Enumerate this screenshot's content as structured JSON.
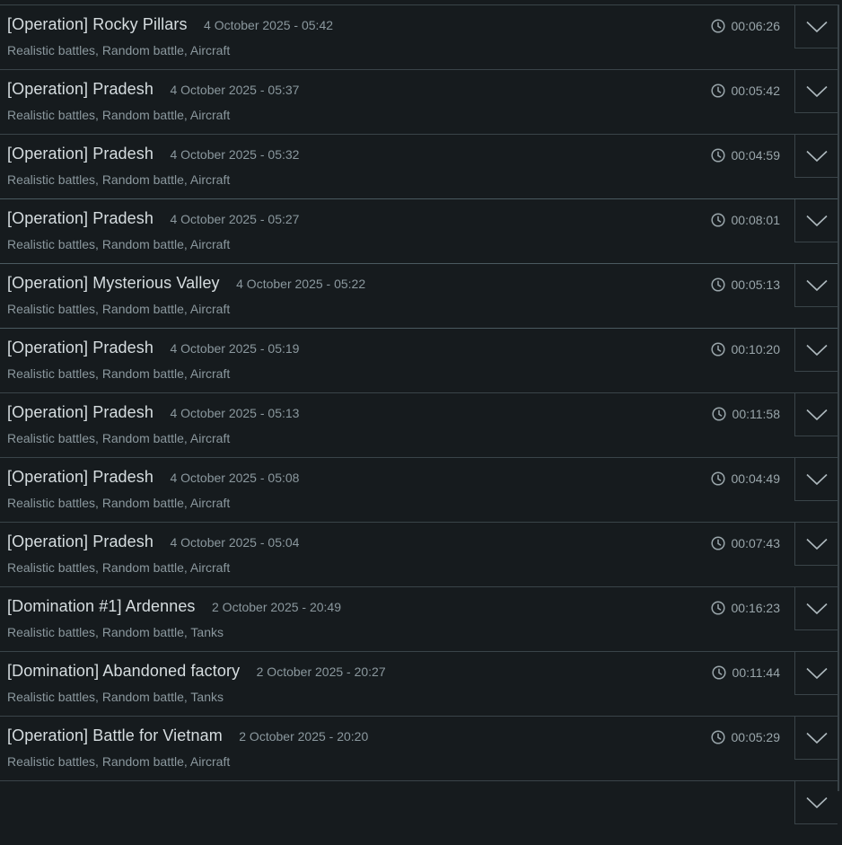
{
  "battles": [
    {
      "title": "[Operation] Rocky Pillars",
      "date": "4 October 2025 - 05:42",
      "meta": "Realistic battles, Random battle, Aircraft",
      "duration": "00:06:26"
    },
    {
      "title": "[Operation] Pradesh",
      "date": "4 October 2025 - 05:37",
      "meta": "Realistic battles, Random battle, Aircraft",
      "duration": "00:05:42"
    },
    {
      "title": "[Operation] Pradesh",
      "date": "4 October 2025 - 05:32",
      "meta": "Realistic battles, Random battle, Aircraft",
      "duration": "00:04:59"
    },
    {
      "title": "[Operation] Pradesh",
      "date": "4 October 2025 - 05:27",
      "meta": "Realistic battles, Random battle, Aircraft",
      "duration": "00:08:01"
    },
    {
      "title": "[Operation] Mysterious Valley",
      "date": "4 October 2025 - 05:22",
      "meta": "Realistic battles, Random battle, Aircraft",
      "duration": "00:05:13"
    },
    {
      "title": "[Operation] Pradesh",
      "date": "4 October 2025 - 05:19",
      "meta": "Realistic battles, Random battle, Aircraft",
      "duration": "00:10:20"
    },
    {
      "title": "[Operation] Pradesh",
      "date": "4 October 2025 - 05:13",
      "meta": "Realistic battles, Random battle, Aircraft",
      "duration": "00:11:58"
    },
    {
      "title": "[Operation] Pradesh",
      "date": "4 October 2025 - 05:08",
      "meta": "Realistic battles, Random battle, Aircraft",
      "duration": "00:04:49"
    },
    {
      "title": "[Operation] Pradesh",
      "date": "4 October 2025 - 05:04",
      "meta": "Realistic battles, Random battle, Aircraft",
      "duration": "00:07:43"
    },
    {
      "title": "[Domination #1] Ardennes",
      "date": "2 October 2025 - 20:49",
      "meta": "Realistic battles, Random battle, Tanks",
      "duration": "00:16:23"
    },
    {
      "title": "[Domination] Abandoned factory",
      "date": "2 October 2025 - 20:27",
      "meta": "Realistic battles, Random battle, Tanks",
      "duration": "00:11:44"
    },
    {
      "title": "[Operation] Battle for Vietnam",
      "date": "2 October 2025 - 20:20",
      "meta": "Realistic battles, Random battle, Aircraft",
      "duration": "00:05:29"
    },
    {
      "title": "",
      "date": "",
      "meta": "",
      "duration": ""
    }
  ],
  "icons": {
    "duration": "clock-icon",
    "expand": "chevron-down-icon"
  },
  "colors": {
    "background": "#161b1e",
    "border": "#3a4449",
    "text": "#d6dde0",
    "muted": "#8b989e"
  }
}
